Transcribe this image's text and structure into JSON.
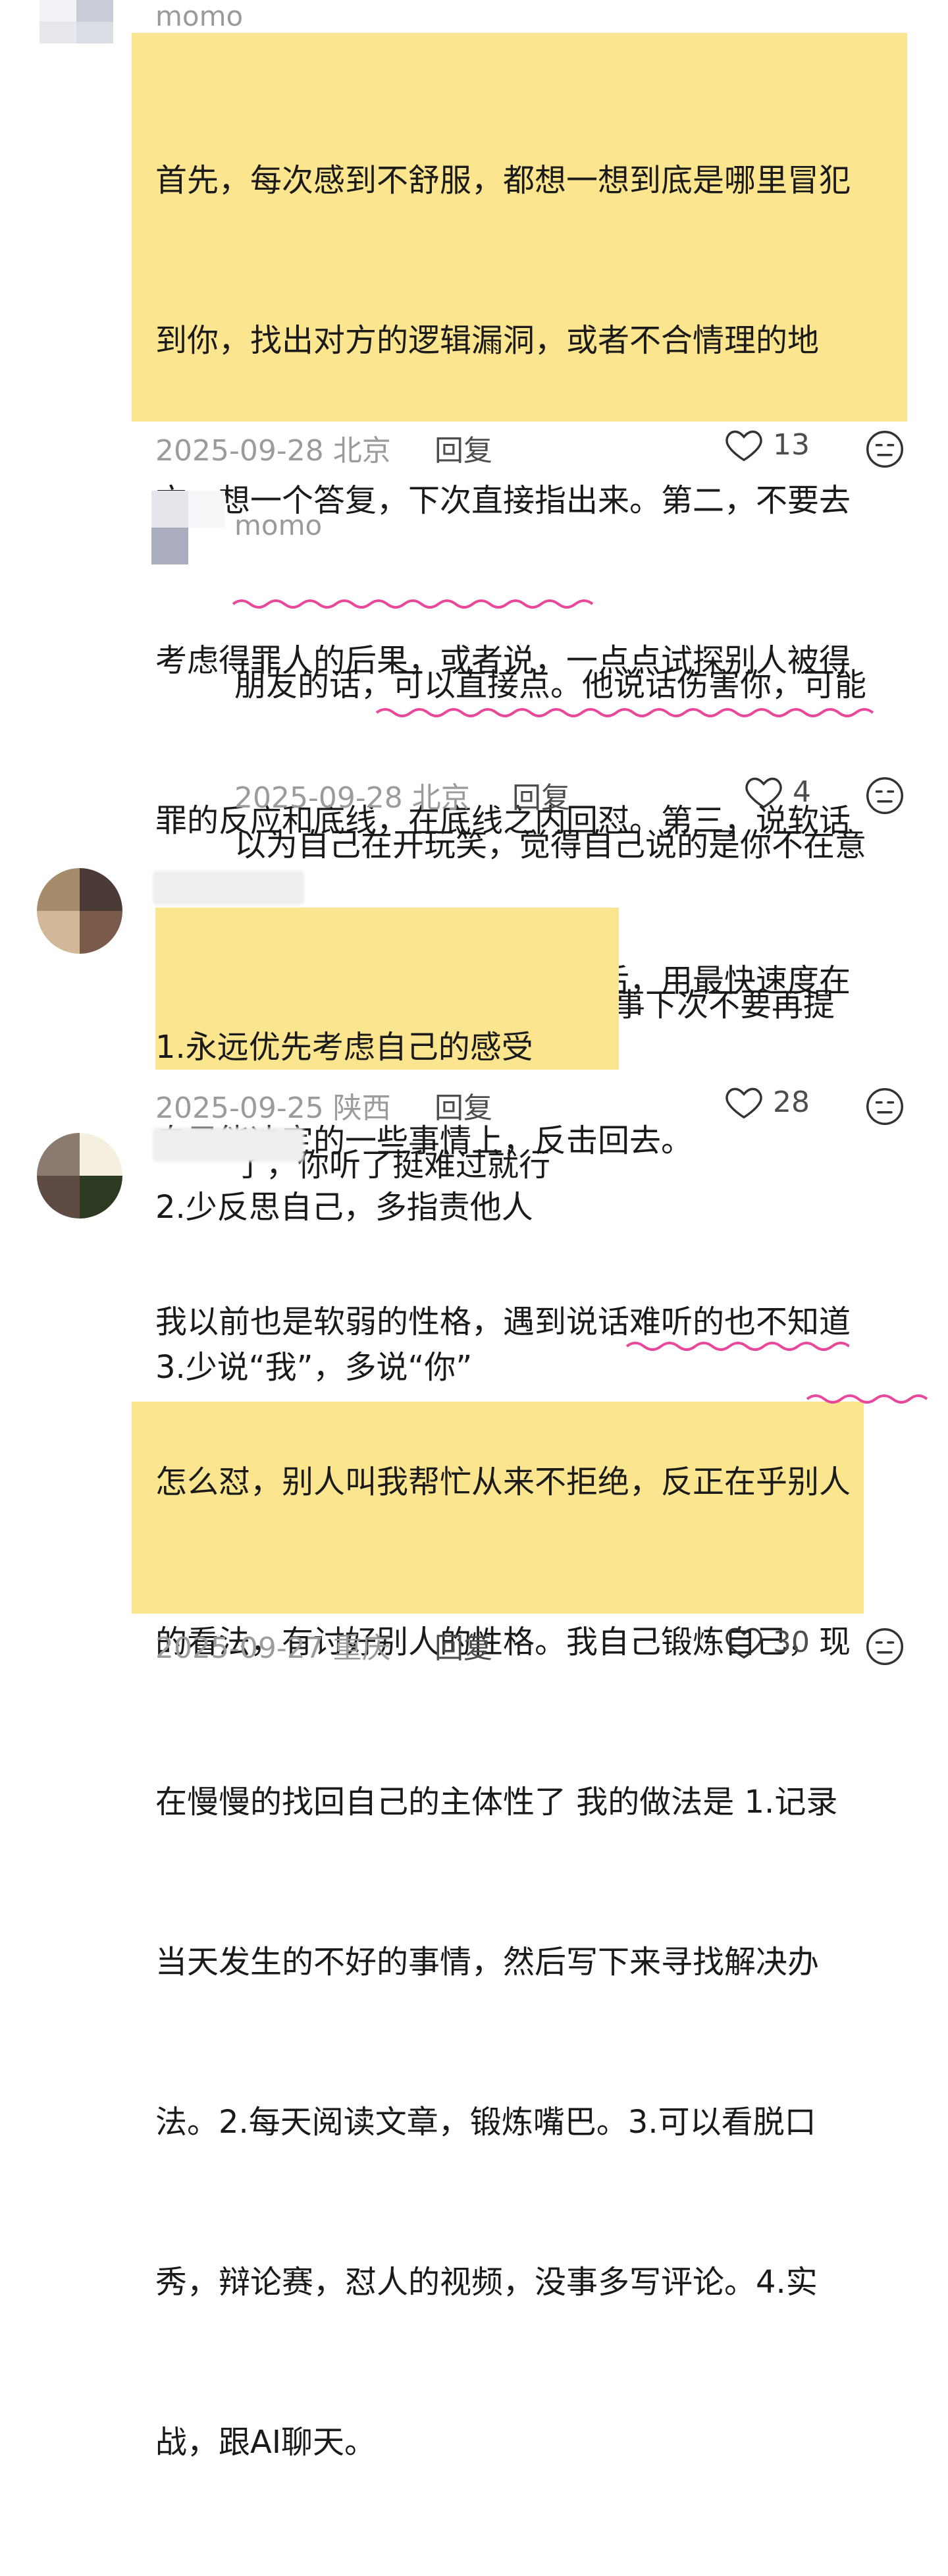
{
  "comments": [
    {
      "username": "momo",
      "lines": [
        "首先，每次感到不舒服，都想一想到底是哪里冒犯",
        "到你，找出对方的逻辑漏洞，或者不合情理的地",
        "方，想一个答复，下次直接指出来。第二，不要去",
        "考虑得罪人的后果，或者说，一点点试探别人被得",
        "罪的反应和底线，在底线之内回怼。第三，说软话",
        "做硬事，话可以客气，但被冒犯后，用最快速度在",
        "自己能决定的一些事情上，反击回去。"
      ],
      "date": "2025-09-28",
      "location": "北京",
      "reply_label": "回复",
      "likes": "13"
    },
    {
      "username": "momo",
      "lines": [
        "朋友的话，可以直接点。他说话伤害你，可能",
        "以为自己在开玩笑，觉得自己说的是你不在意",
        "的事。你直接告诉他，什么事下次不要再提",
        "了，你听了挺难过就行"
      ],
      "date": "2025-09-28",
      "location": "北京",
      "reply_label": "回复",
      "likes": "4"
    },
    {
      "username": "",
      "lines": [
        "1.永远优先考虑自己的感受",
        "2.少反思自己，多指责他人",
        "3.少说“我”，多说“你”"
      ],
      "date": "2025-09-25",
      "location": "陕西",
      "reply_label": "回复",
      "likes": "28"
    },
    {
      "username": "",
      "lines": [
        "我以前也是软弱的性格，遇到说话难听的也不知道",
        "怎么怼，别人叫我帮忙从来不拒绝，反正在乎别人",
        "的看法，有讨好别人的性格。我自己锻炼自己，现",
        "在慢慢的找回自己的主体性了     我的做法是 1.记录",
        "当天发生的不好的事情，然后写下来寻找解决办",
        "法。2.每天阅读文章，锻炼嘴巴。3.可以看脱口",
        "秀，辩论赛，怼人的视频，没事多写评论。4.实",
        "战，跟AI聊天。"
      ],
      "date": "2025-09-27",
      "location": "重庆",
      "reply_label": "回复",
      "likes": "30"
    }
  ],
  "colors": {
    "highlight": "#fce58f",
    "underline": "#e8479a",
    "meta": "#9b9b9b"
  },
  "icons": [
    "heart-icon",
    "meh-face-icon"
  ]
}
